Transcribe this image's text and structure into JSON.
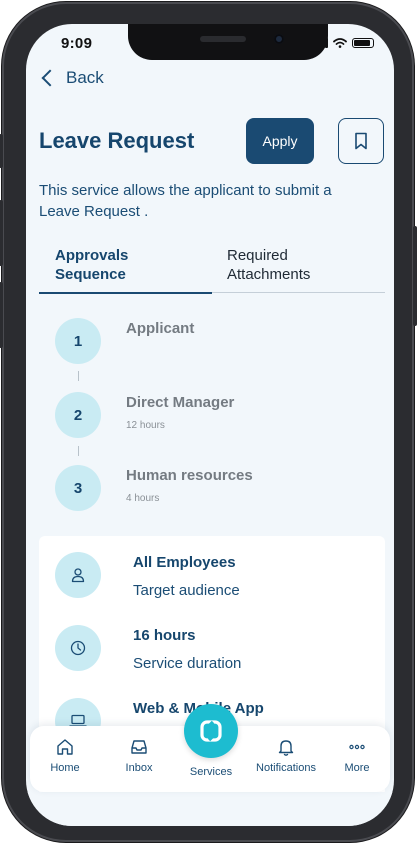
{
  "status_bar": {
    "time": "9:09"
  },
  "header": {
    "back_label": "Back",
    "title": "Leave Request",
    "apply_label": "Apply"
  },
  "description": "This service allows the applicant to submit a Leave Request .",
  "tabs": [
    {
      "label": "Approvals Sequence",
      "active": true
    },
    {
      "label": "Required Attachments",
      "active": false
    }
  ],
  "steps": [
    {
      "number": "1",
      "title": "Applicant",
      "subtitle": ""
    },
    {
      "number": "2",
      "title": "Direct Manager",
      "subtitle": "12 hours"
    },
    {
      "number": "3",
      "title": "Human resources",
      "subtitle": "4 hours"
    }
  ],
  "info": [
    {
      "icon": "person-icon",
      "title": "All Employees",
      "subtitle": "Target audience"
    },
    {
      "icon": "clock-icon",
      "title": "16 hours",
      "subtitle": "Service duration"
    },
    {
      "icon": "laptop-icon",
      "title": "Web & Mobile App",
      "subtitle": ""
    }
  ],
  "bottom_nav": [
    {
      "icon": "home-icon",
      "label": "Home"
    },
    {
      "icon": "inbox-icon",
      "label": "Inbox"
    },
    {
      "icon": "services-icon",
      "label": "Services"
    },
    {
      "icon": "bell-icon",
      "label": "Notifications"
    },
    {
      "icon": "more-icon",
      "label": "More"
    }
  ],
  "colors": {
    "primary": "#1a4a72",
    "accent": "#1dbcd0",
    "screen_bg": "#f2f7fb",
    "icon_bg": "#c9ebf3"
  }
}
